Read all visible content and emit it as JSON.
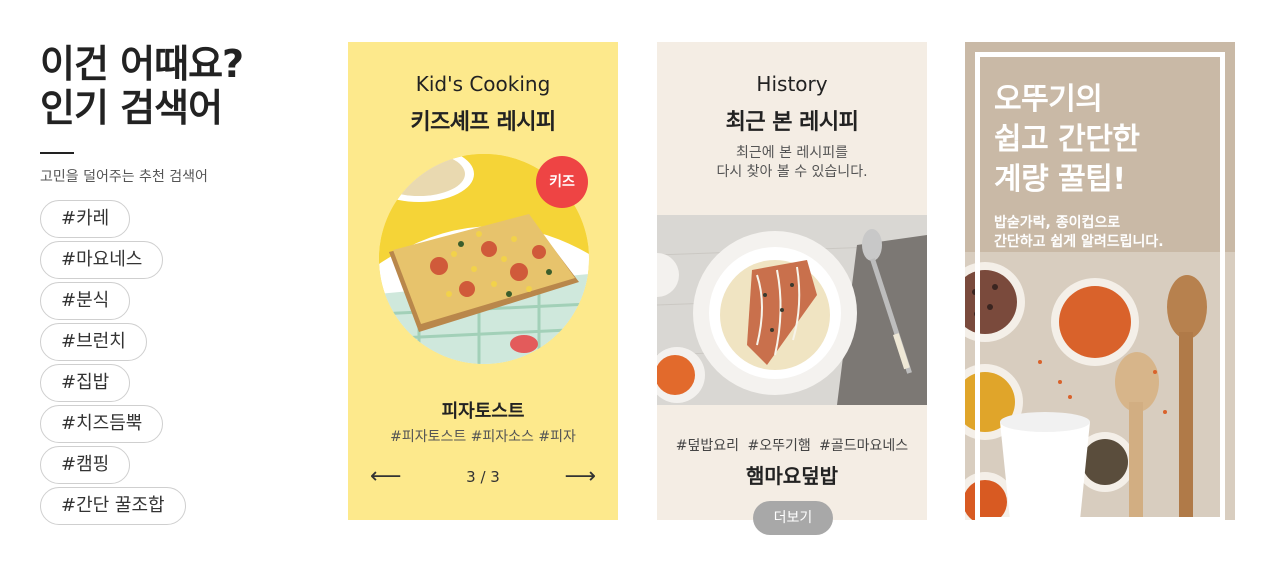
{
  "popular": {
    "heading_line1": "이건 어때요?",
    "heading_line2": "인기 검색어",
    "subtitle": "고민을 덜어주는 추천 검색어",
    "tags": [
      "#카레",
      "#마요네스",
      "#분식",
      "#브런치",
      "#집밥",
      "#치즈듬뿍",
      "#캠핑",
      "#간단 꿀조합"
    ]
  },
  "kids_card": {
    "eyebrow": "Kid's Cooking",
    "title": "키즈셰프 레시피",
    "badge": "키즈",
    "recipe_name": "피자토스트",
    "recipe_tags": "#피자토스트 #피자소스 #피자",
    "pager": "3 / 3",
    "prev_arrow": "⟵",
    "next_arrow": "⟶",
    "bg_color": "#fde98c"
  },
  "history_card": {
    "eyebrow": "History",
    "title": "최근 본 레시피",
    "desc_line1": "최근에 본 레시피를",
    "desc_line2": "다시 찾아 볼 수 있습니다.",
    "recipe_tags": "#덮밥요리 #오뚜기햄 #골드마요네스",
    "recipe_name": "햄마요덮밥",
    "more_button": "더보기",
    "bg_color": "#f4ede4"
  },
  "tip_card": {
    "title_line1": "오뚜기의",
    "title_line2": "쉽고 간단한",
    "title_line3": "계량 꿀팁!",
    "desc_line1": "밥숟가락, 종이컵으로",
    "desc_line2": "간단하고 쉽게 알려드립니다.",
    "bg_color": "#c9b9a6"
  }
}
